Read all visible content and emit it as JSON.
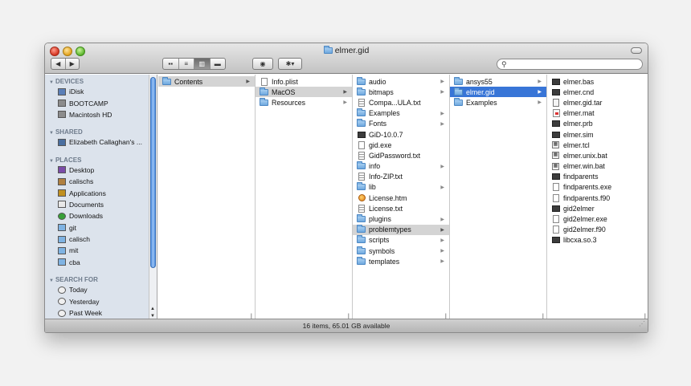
{
  "window": {
    "title": "elmer.gid",
    "status": "16 items, 65.01 GB available"
  },
  "toolbar": {
    "back_label": "◀",
    "forward_label": "▶",
    "view_icons": [
      "icon-view-icon",
      "list-view-icon",
      "column-view-icon",
      "coverflow-view-icon"
    ],
    "view_glyphs": [
      "▪▪",
      "≡",
      "▥",
      "▬"
    ],
    "selected_view": 2,
    "quicklook_glyph": "◉",
    "action_glyph": "✱▾",
    "search_placeholder": ""
  },
  "sidebar": {
    "sections": [
      {
        "title": "DEVICES",
        "items": [
          {
            "label": "iDisk",
            "icon": "idisk-icon"
          },
          {
            "label": "BOOTCAMP",
            "icon": "drive-icon"
          },
          {
            "label": "Macintosh HD",
            "icon": "drive-icon"
          }
        ]
      },
      {
        "title": "SHARED",
        "items": [
          {
            "label": "Elizabeth Callaghan's ...",
            "icon": "computer-icon"
          }
        ]
      },
      {
        "title": "PLACES",
        "items": [
          {
            "label": "Desktop",
            "icon": "desktop-icon"
          },
          {
            "label": "calischs",
            "icon": "home-icon"
          },
          {
            "label": "Applications",
            "icon": "applications-icon"
          },
          {
            "label": "Documents",
            "icon": "documents-icon"
          },
          {
            "label": "Downloads",
            "icon": "downloads-icon"
          },
          {
            "label": "git",
            "icon": "folder-icon"
          },
          {
            "label": "calisch",
            "icon": "folder-icon"
          },
          {
            "label": "mit",
            "icon": "folder-icon"
          },
          {
            "label": "cba",
            "icon": "folder-icon"
          }
        ]
      },
      {
        "title": "SEARCH FOR",
        "items": [
          {
            "label": "Today",
            "icon": "clock-icon"
          },
          {
            "label": "Yesterday",
            "icon": "clock-icon"
          },
          {
            "label": "Past Week",
            "icon": "clock-icon"
          }
        ]
      }
    ]
  },
  "columns": [
    {
      "items": [
        {
          "label": "Contents",
          "type": "folder",
          "arrow": true,
          "state": "grey"
        }
      ]
    },
    {
      "items": [
        {
          "label": "Info.plist",
          "type": "doc",
          "arrow": false
        },
        {
          "label": "MacOS",
          "type": "folder",
          "arrow": true,
          "state": "grey"
        },
        {
          "label": "Resources",
          "type": "folder",
          "arrow": true
        }
      ]
    },
    {
      "items": [
        {
          "label": "audio",
          "type": "folder",
          "arrow": true
        },
        {
          "label": "bitmaps",
          "type": "folder",
          "arrow": true
        },
        {
          "label": "Compa...ULA.txt",
          "type": "text",
          "arrow": false
        },
        {
          "label": "Examples",
          "type": "folder",
          "arrow": true
        },
        {
          "label": "Fonts",
          "type": "folder",
          "arrow": true
        },
        {
          "label": "GiD-10.0.7",
          "type": "exec",
          "arrow": false
        },
        {
          "label": "gid.exe",
          "type": "doc",
          "arrow": false
        },
        {
          "label": "GidPassword.txt",
          "type": "text",
          "arrow": false
        },
        {
          "label": "info",
          "type": "folder",
          "arrow": true
        },
        {
          "label": "Info-ZIP.txt",
          "type": "text",
          "arrow": false
        },
        {
          "label": "lib",
          "type": "folder",
          "arrow": true
        },
        {
          "label": "License.htm",
          "type": "html",
          "arrow": false
        },
        {
          "label": "License.txt",
          "type": "text",
          "arrow": false
        },
        {
          "label": "plugins",
          "type": "folder",
          "arrow": true
        },
        {
          "label": "problemtypes",
          "type": "folder",
          "arrow": true,
          "state": "grey"
        },
        {
          "label": "scripts",
          "type": "folder",
          "arrow": true
        },
        {
          "label": "symbols",
          "type": "folder",
          "arrow": true
        },
        {
          "label": "templates",
          "type": "folder",
          "arrow": true
        }
      ]
    },
    {
      "items": [
        {
          "label": "ansys55",
          "type": "folder",
          "arrow": true
        },
        {
          "label": "elmer.gid",
          "type": "folder",
          "arrow": true,
          "state": "blue"
        },
        {
          "label": "Examples",
          "type": "folder",
          "arrow": true
        }
      ]
    },
    {
      "items": [
        {
          "label": "elmer.bas",
          "type": "exec",
          "arrow": false
        },
        {
          "label": "elmer.cnd",
          "type": "exec",
          "arrow": false
        },
        {
          "label": "elmer.gid.tar",
          "type": "tar",
          "arrow": false
        },
        {
          "label": "elmer.mat",
          "type": "mat",
          "arrow": false
        },
        {
          "label": "elmer.prb",
          "type": "exec",
          "arrow": false
        },
        {
          "label": "elmer.sim",
          "type": "exec",
          "arrow": false
        },
        {
          "label": "elmer.tcl",
          "type": "tcl",
          "arrow": false
        },
        {
          "label": "elmer.unix.bat",
          "type": "tcl",
          "arrow": false
        },
        {
          "label": "elmer.win.bat",
          "type": "tcl",
          "arrow": false
        },
        {
          "label": "findparents",
          "type": "exec",
          "arrow": false
        },
        {
          "label": "findparents.exe",
          "type": "doc",
          "arrow": false
        },
        {
          "label": "findparents.f90",
          "type": "doc",
          "arrow": false
        },
        {
          "label": "gid2elmer",
          "type": "exec",
          "arrow": false
        },
        {
          "label": "gid2elmer.exe",
          "type": "doc",
          "arrow": false
        },
        {
          "label": "gid2elmer.f90",
          "type": "doc",
          "arrow": false
        },
        {
          "label": "libcxa.so.3",
          "type": "exec",
          "arrow": false
        }
      ]
    }
  ],
  "colors": {
    "selection_blue": "#3875d7",
    "selection_grey": "#d4d4d4",
    "sidebar_bg": "#dce3ec"
  }
}
